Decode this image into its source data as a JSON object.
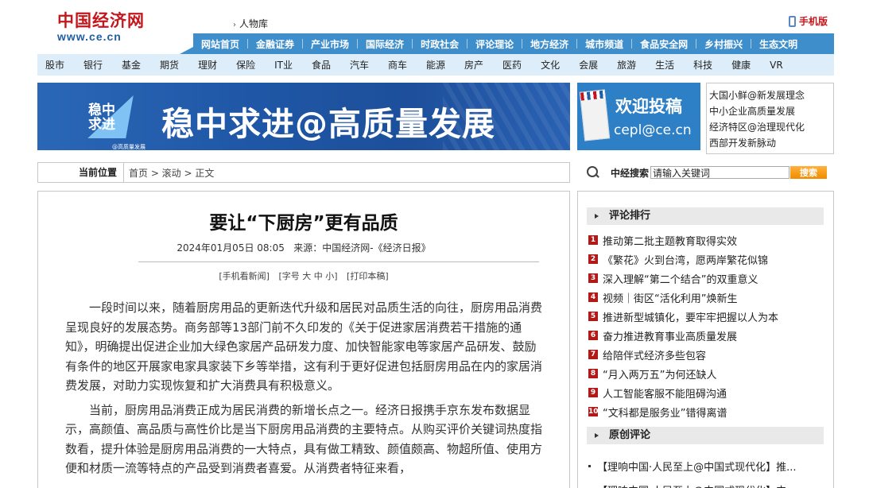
{
  "header": {
    "logo_cn": "中国经济网",
    "logo_en": "www.ce.cn",
    "people_link": "人物库",
    "mobile_label": "手机版"
  },
  "nav_primary": [
    "网站首页",
    "金融证券",
    "产业市场",
    "国际经济",
    "时政社会",
    "评论理论",
    "地方经济",
    "城市频道",
    "食品安全网",
    "乡村振兴",
    "生态文明"
  ],
  "nav_secondary": [
    "股市",
    "银行",
    "基金",
    "期货",
    "理财",
    "保险",
    "IT业",
    "食品",
    "汽车",
    "商车",
    "能源",
    "房产",
    "医药",
    "文化",
    "会展",
    "旅游",
    "生活",
    "科技",
    "健康",
    "VR"
  ],
  "banner": {
    "emblem_text": "稳中\n求进",
    "emblem_caption": "@高质量发展",
    "title": "稳中求进@高质量发展"
  },
  "submit_banner": {
    "title": "欢迎投稿",
    "email": "cepl@ce.cn"
  },
  "side_links": [
    "大国小鲜@新发展理念",
    "中小企业高质量发展",
    "经济特区@治理现代化",
    "西部开发新脉动"
  ],
  "breadcrumb": {
    "label": "当前位置",
    "path": "首页 > 滚动 > 正文"
  },
  "search": {
    "label": "中经搜索",
    "value": "请输入关键词",
    "button": "搜索"
  },
  "article": {
    "title": "要让“下厨房”更有品质",
    "meta": "2024年01月05日 08:05   来源：中国经济网-《经济日报》",
    "tools": [
      "[手机看新闻]",
      "[字号 大 中 小]",
      "[打印本稿]"
    ],
    "paragraphs": [
      "一段时间以来，随着厨房用品的更新迭代升级和居民对品质生活的向往，厨房用品消费呈现良好的发展态势。商务部等13部门前不久印发的《关于促进家居消费若干措施的通知》，明确提出促进企业加大绿色家居产品研发力度、加快智能家电等家居产品研发、鼓励有条件的地区开展家电家具家装下乡等举措，这有利于更好促进包括厨房用品在内的家居消费发展，对助力实现恢复和扩大消费具有积极意义。",
      "当前，厨房用品消费正成为居民消费的新增长点之一。经济日报携手京东发布数据显示，高颜值、高品质与高性价比是当下厨房用品消费的主要特点。从购买评价关键词热度指数看，提升体验是厨房用品消费的一大特点，具有做工精致、颜值颇高、物超所值、使用方便和材质一流等特点的产品受到消费者喜爱。从消费者特征来看，"
    ]
  },
  "ranking": {
    "title": "评论排行",
    "items": [
      "推动第二批主题教育取得实效",
      "《繁花》火到台湾，愿两岸繁花似锦",
      "深入理解“第二个结合”的双重意义",
      "视频｜街区“活化利用”焕新生",
      "推进新型城镇化，要牢牢把握以人为本",
      "奋力推进教育事业高质量发展",
      "给陪伴式经济多些包容",
      "“月入两万五”为何还缺人",
      "人工智能客服不能阻碍沟通",
      "“文科都是服务业”错得离谱"
    ]
  },
  "original": {
    "title": "原创评论",
    "items": [
      "【理响中国·人民至上@中国式现代化】推...",
      "【理响中国·人民至上@中国式现代化】中..."
    ]
  },
  "colors": {
    "brand_red": "#c4161c",
    "nav_blue": "#3f8ecc",
    "subnav_bg": "#ddeefa",
    "rank_badge": "#b21a1a",
    "search_button": "#f08c00"
  }
}
